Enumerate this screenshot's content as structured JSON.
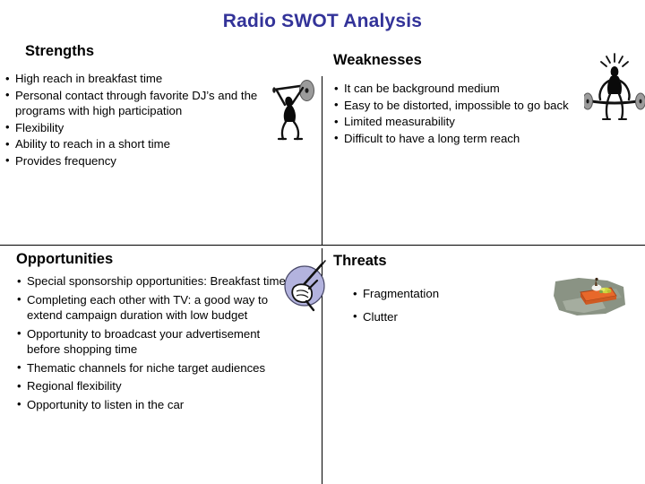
{
  "slide": {
    "title": "Radio SWOT Analysis",
    "title_color": "#333399",
    "background_color": "#FFFFFF"
  },
  "quadrants": {
    "strengths": {
      "heading": "Strengths",
      "icon": "weightlifter-overhead-icon",
      "bullets": [
        "High reach in breakfast time",
        "Personal  contact through  favorite DJ’s and the programs with  high participation",
        "Flexibility",
        "Ability to reach in a short time",
        "Provides frequency"
      ]
    },
    "weaknesses": {
      "heading": "Weaknesses",
      "icon": "weightlifter-straining-icon",
      "bullets": [
        "It can be background  medium",
        "Easy to be distorted, impossible to go back",
        "Limited measurability",
        "Difficult to have a long term reach"
      ]
    },
    "opportunities": {
      "heading": "Opportunities",
      "icon": "hand-holding-pen-circle-icon",
      "bullets": [
        "Special sponsorship  opportunities: Breakfast time",
        "Completing each other with TV: a good way to extend  campaign  duration with low budget",
        "Opportunity to broadcast your advertisement before shopping time",
        "Thematic channels for niche target audiences",
        "Regional flexibility",
        "Opportunity to listen in the car"
      ]
    },
    "threats": {
      "heading": "Threats",
      "icon": "raft-on-water-icon",
      "bullets": [
        "Fragmentation",
        "Clutter"
      ]
    }
  },
  "colors": {
    "title_navy": "#333399",
    "text_black": "#000000",
    "divider_black": "#000000",
    "opportunity_circle_lavender": "#B3B3DE",
    "threat_raft_orange": "#E8682A",
    "threat_water_gray": "#8A9384",
    "icon_black": "#0A0A0A",
    "barbell_gray": "#9A9A9A"
  }
}
